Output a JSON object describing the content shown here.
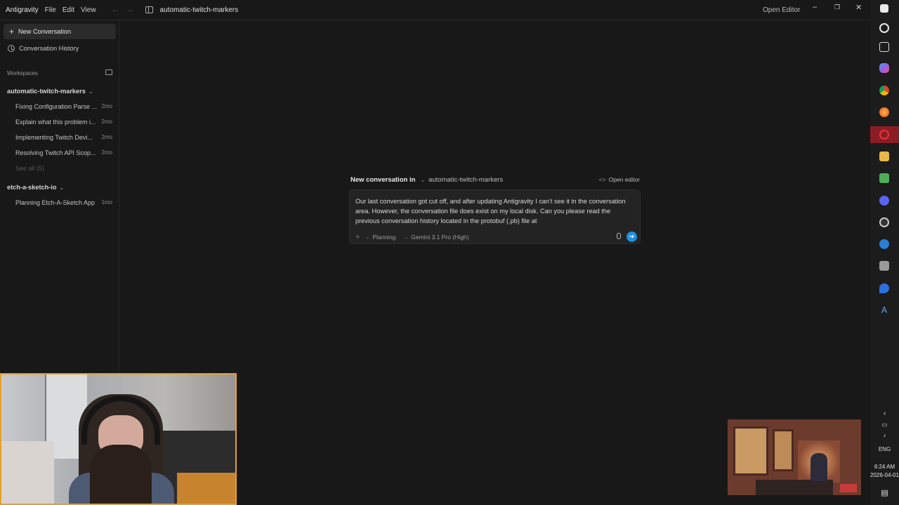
{
  "titlebar": {
    "app_name": "Antigravity",
    "menus": [
      "File",
      "Edit",
      "View"
    ],
    "workspace_title": "automatic-twitch-markers",
    "open_editor": "Open Editor",
    "min_glyph": "–",
    "max_glyph": "❐",
    "close_glyph": "✕",
    "back_glyph": "←",
    "fwd_glyph": "→"
  },
  "sidebar": {
    "new_conversation": "New Conversation",
    "conversation_history": "Conversation History",
    "workspaces_label": "Workspaces",
    "workspaces": [
      {
        "name": "automatic-twitch-markers",
        "conversations": [
          {
            "title": "Fixing Configuration Parse ...",
            "age": "2mo"
          },
          {
            "title": "Explain what this problem i...",
            "age": "2mo"
          },
          {
            "title": "Implementing Twitch Devi...",
            "age": "2mo"
          },
          {
            "title": "Resolving Twitch API Scop...",
            "age": "2mo"
          }
        ],
        "see_all": "See all (5)"
      },
      {
        "name": "etch-a-sketch-io",
        "conversations": [
          {
            "title": "Planning Etch-A-Sketch App",
            "age": "1mo"
          }
        ]
      }
    ]
  },
  "composer": {
    "heading_lead": "New conversation in",
    "heading_workspace": "automatic-twitch-markers",
    "open_editor": "Open editor",
    "open_editor_icon": "code-icon",
    "input_text": "Our last conversation got cut off, and after updating Antigravity I can't see it in the conversation area. However, the conversation file does exist on my local disk. Can you please read the previous conversation history located in the protobuf (.pb) file at",
    "mode": "Planning",
    "model": "Gemini 3.1 Pro (High)",
    "send_color": "#1f8fe0"
  },
  "taskbar": {
    "language": "ENG",
    "time": "6:24 AM",
    "date": "2026-04-01",
    "icons": [
      "windows-icon",
      "search-icon",
      "task-view-icon",
      "copilot-icon",
      "chrome-icon",
      "firefox-icon",
      "opera-icon",
      "file-explorer-icon",
      "notepad-icon",
      "discord-icon",
      "obs-icon",
      "steam-icon",
      "drive-icon",
      "maps-icon",
      "antigravity-icon"
    ],
    "selected_color": "#8a1d24"
  },
  "colors": {
    "background": "#181818",
    "composer_bg": "#232323",
    "webcam_border": "#e6a128"
  }
}
